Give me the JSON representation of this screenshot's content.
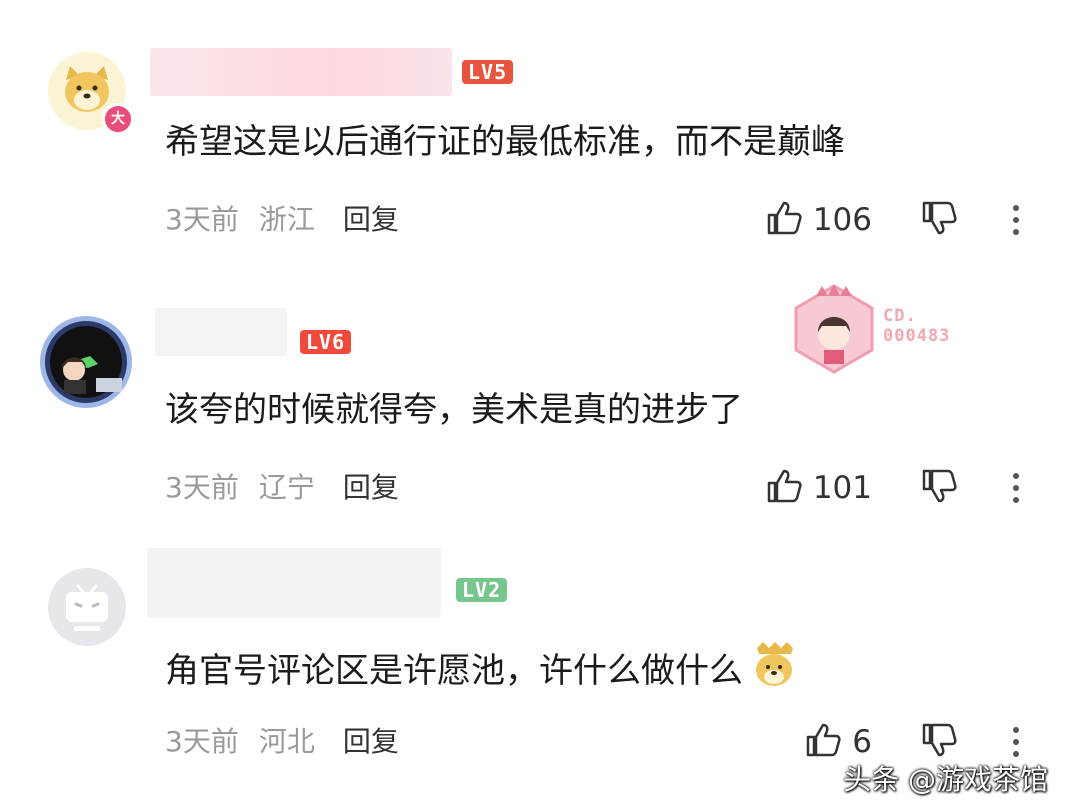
{
  "comments": [
    {
      "level": "LV5",
      "level_color": "#e8553e",
      "text": "希望这是以后通行证的最低标准，而不是巅峰",
      "time": "3天前",
      "location": "浙江",
      "reply_label": "回复",
      "likes": "106",
      "avatar_badge": "大"
    },
    {
      "level": "LV6",
      "level_color": "#f04a3a",
      "text": "该夸的时候就得夸，美术是真的进步了",
      "time": "3天前",
      "location": "辽宁",
      "reply_label": "回复",
      "likes": "101",
      "dress_code": "CD.\n000483"
    },
    {
      "level": "LV2",
      "level_color": "#77c68e",
      "text": "角官号评论区是许愿池，许什么做什么",
      "time": "3天前",
      "location": "河北",
      "reply_label": "回复",
      "likes": "6"
    }
  ],
  "watermark": "头条 @游戏茶馆",
  "icons": [
    "thumbs-up-icon",
    "thumbs-down-icon",
    "more-icon"
  ]
}
